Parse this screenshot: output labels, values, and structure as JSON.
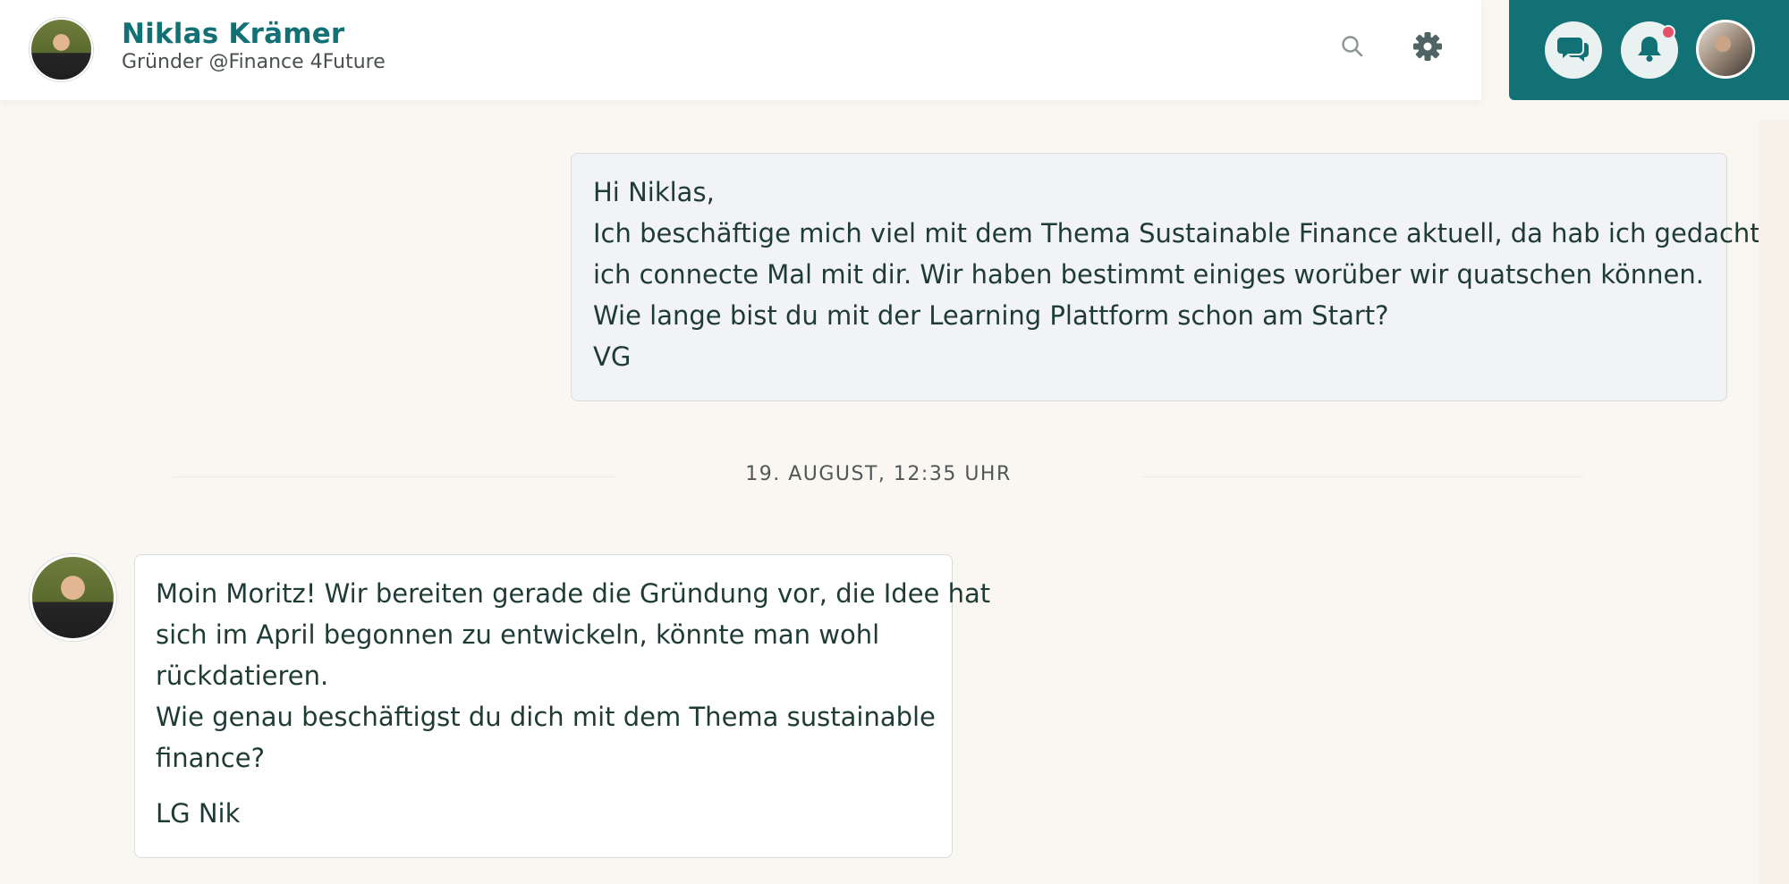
{
  "header": {
    "name": "Niklas Krämer",
    "subtitle": "Gründer @Finance 4Future"
  },
  "icons": {
    "search": "search-icon",
    "settings": "gear-icon",
    "chat": "chat-bubbles-icon",
    "notifications": "bell-icon"
  },
  "notifications": {
    "has_unread": true,
    "dot_color": "#e8506a"
  },
  "colors": {
    "accent": "#127174",
    "background": "#faf7f3",
    "sent_bubble": "#f2f3f4",
    "received_bubble": "#ffffff"
  },
  "messages": [
    {
      "direction": "sent",
      "lines": [
        "Hi Niklas,",
        "Ich beschäftige mich viel mit dem Thema Sustainable Finance aktuell, da hab ich gedacht,",
        "ich connecte Mal mit dir. Wir haben bestimmt einiges worüber wir quatschen können.",
        "Wie lange bist du mit der Learning Plattform schon am Start?",
        "VG"
      ]
    },
    {
      "direction": "received",
      "lines": [
        "Moin Moritz! Wir bereiten gerade die Gründung vor, die Idee hat",
        "sich im April begonnen zu entwickeln, könnte man wohl",
        "rückdatieren.",
        "Wie genau beschäftigst du dich mit dem Thema sustainable",
        "finance?"
      ],
      "signature": "LG Nik"
    }
  ],
  "date_divider": "19. AUGUST, 12:35 UHR"
}
